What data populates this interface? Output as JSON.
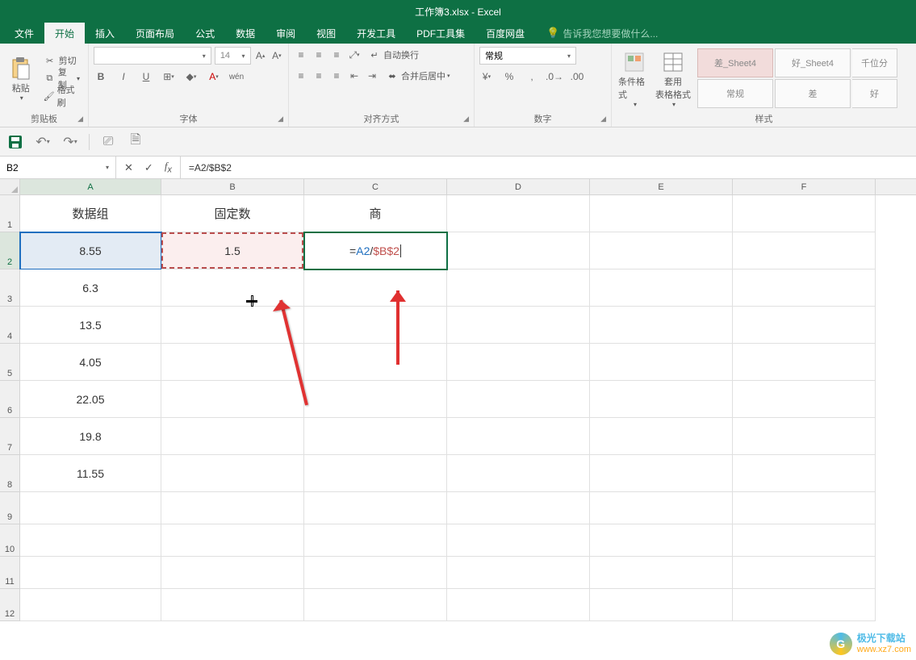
{
  "app": {
    "title": "工作簿3.xlsx - Excel"
  },
  "tabs": {
    "file": "文件",
    "home": "开始",
    "insert": "插入",
    "page_layout": "页面布局",
    "formulas": "公式",
    "data": "数据",
    "review": "审阅",
    "view": "视图",
    "developer": "开发工具",
    "pdf": "PDF工具集",
    "baidu": "百度网盘",
    "tellme": "告诉我您想要做什么..."
  },
  "clipboard": {
    "paste": "粘贴",
    "cut": "剪切",
    "copy": "复制",
    "format_painter": "格式刷",
    "group": "剪贴板"
  },
  "font": {
    "name_placeholder": "",
    "size": "14",
    "group": "字体",
    "B": "B",
    "I": "I",
    "U": "U",
    "wen": "wén"
  },
  "align": {
    "wrap": "自动换行",
    "merge": "合并后居中",
    "group": "对齐方式"
  },
  "number": {
    "format": "常规",
    "group": "数字"
  },
  "styles": {
    "cond": "条件格式",
    "table": "套用\n表格格式",
    "group": "样式",
    "s1": "差_Sheet4",
    "s2": "好_Sheet4",
    "s3": "千位分",
    "s4": "常规",
    "s5": "差",
    "s6": "好"
  },
  "namebox": "B2",
  "formula": "=A2/$B$2",
  "columns": [
    "A",
    "B",
    "C",
    "D",
    "E",
    "F"
  ],
  "rows": [
    "1",
    "2",
    "3",
    "4",
    "5",
    "6",
    "7",
    "8",
    "9",
    "10",
    "11",
    "12"
  ],
  "sheet": {
    "headers": {
      "A": "数据组",
      "B": "固定数",
      "C": "商"
    },
    "A": [
      "8.55",
      "6.3",
      "13.5",
      "4.05",
      "22.05",
      "19.8",
      "11.55"
    ],
    "B2": "1.5",
    "C2_formula": {
      "eq": "=",
      "a": "A2",
      "slash": "/",
      "b": "$B$2"
    }
  },
  "watermark": {
    "brand": "极光下载站",
    "url": "www.xz7.com"
  },
  "chart_data": {
    "type": "table",
    "title": "",
    "columns": [
      "数据组",
      "固定数",
      "商"
    ],
    "rows": [
      [
        8.55,
        1.5,
        null
      ],
      [
        6.3,
        null,
        null
      ],
      [
        13.5,
        null,
        null
      ],
      [
        4.05,
        null,
        null
      ],
      [
        22.05,
        null,
        null
      ],
      [
        19.8,
        null,
        null
      ],
      [
        11.55,
        null,
        null
      ]
    ],
    "active_formula": "=A2/$B$2"
  }
}
